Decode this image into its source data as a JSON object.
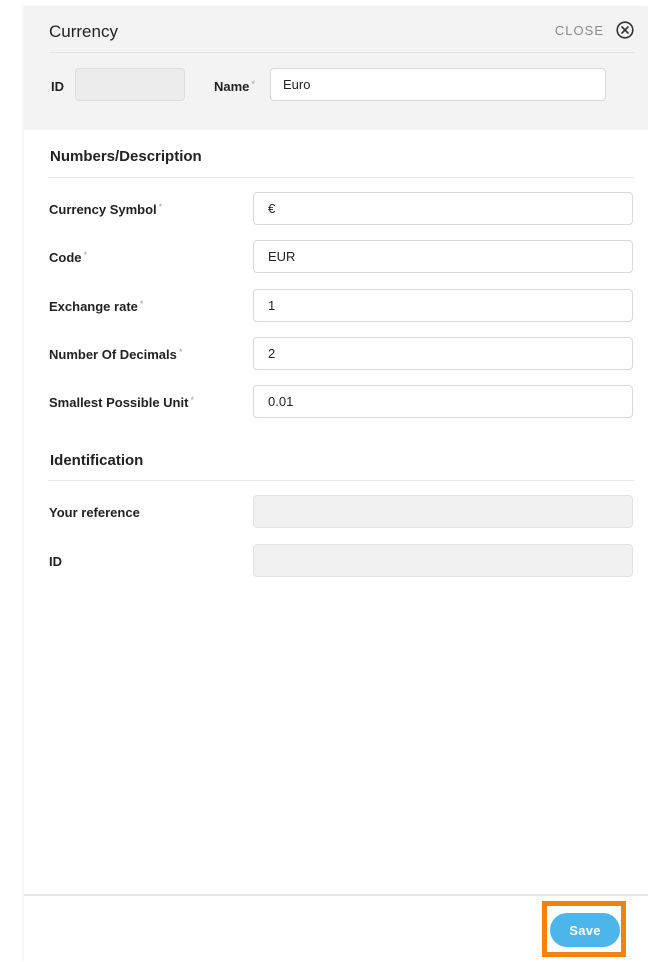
{
  "header": {
    "title": "Currency",
    "close_label": "CLOSE",
    "close_icon": "close-circle-icon",
    "id_label": "ID",
    "id_value": "",
    "name_label": "Name",
    "name_value": "Euro",
    "required_mark": "*"
  },
  "numbers_section": {
    "title": "Numbers/Description",
    "fields": [
      {
        "label": "Currency Symbol",
        "value": "€",
        "required": true
      },
      {
        "label": "Code",
        "value": "EUR",
        "required": true
      },
      {
        "label": "Exchange rate",
        "value": "1",
        "required": true
      },
      {
        "label": "Number Of Decimals",
        "value": "2",
        "required": true
      },
      {
        "label": "Smallest Possible Unit",
        "value": "0.01",
        "required": true
      }
    ]
  },
  "identification_section": {
    "title": "Identification",
    "fields": [
      {
        "label": "Your reference",
        "value": ""
      },
      {
        "label": "ID",
        "value": ""
      }
    ]
  },
  "footer": {
    "save_label": "Save",
    "save_color": "#4cb6ea",
    "highlight_color": "#f5820a"
  }
}
